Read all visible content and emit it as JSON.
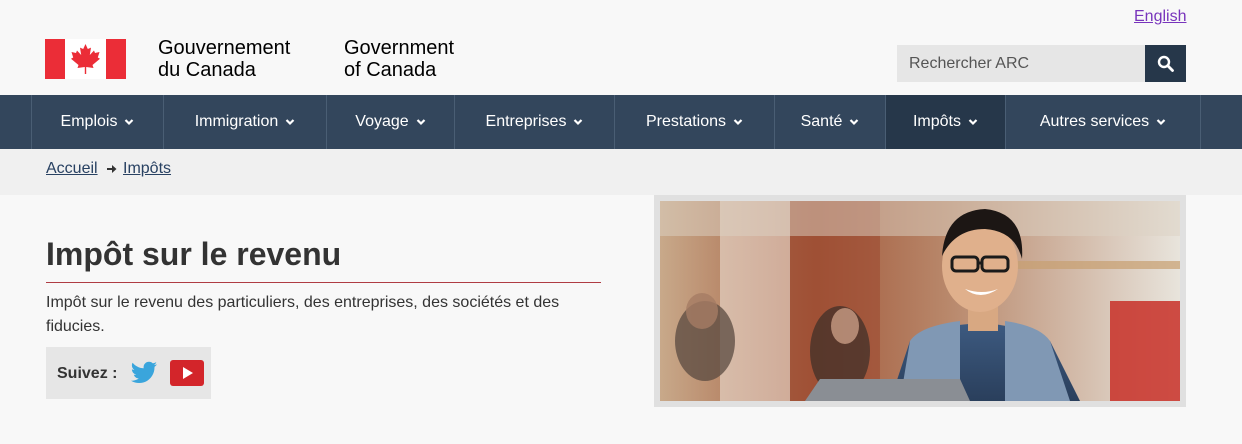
{
  "header": {
    "language_link": "English",
    "signature_fr_line1": "Gouvernement",
    "signature_fr_line2": "du Canada",
    "signature_en_line1": "Government",
    "signature_en_line2": "of Canada",
    "search_placeholder": "Rechercher ARC",
    "icons": {
      "search": "search-icon",
      "flag": "canada-flag-icon"
    }
  },
  "menu": {
    "items": [
      {
        "label": "Emplois"
      },
      {
        "label": "Immigration"
      },
      {
        "label": "Voyage"
      },
      {
        "label": "Entreprises"
      },
      {
        "label": "Prestations"
      },
      {
        "label": "Santé"
      },
      {
        "label": "Impôts"
      },
      {
        "label": "Autres services"
      }
    ],
    "active": "Impôts"
  },
  "breadcrumb": {
    "items": [
      "Accueil",
      "Impôts"
    ]
  },
  "main": {
    "title": "Impôt sur le revenu",
    "description": "Impôt sur le revenu des particuliers, des entreprises, des sociétés et des fiducies.",
    "follow_label": "Suivez :",
    "social_icons": [
      "twitter-icon",
      "youtube-icon"
    ]
  },
  "colors": {
    "menu_bg": "#33465c",
    "menu_active": "#26374a",
    "accent_red": "#af3c43",
    "link_visited": "#7834bc",
    "flag_red": "#eb2d37"
  }
}
